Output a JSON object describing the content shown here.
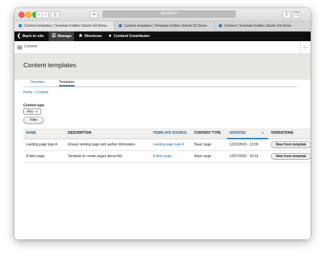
{
  "browser": {
    "address": "localhost",
    "tabs": [
      {
        "label": "Content templates | Template Entities Starter Kit Demo",
        "active": true
      },
      {
        "label": "Content templates | Template Entities Starter Kit Demo",
        "active": false
      },
      {
        "label": "Content | Template Entities Starter Kit Demo",
        "active": false
      }
    ]
  },
  "toolbar": {
    "back_label": "Back to site",
    "manage_label": "Manage",
    "shortcuts_label": "Shortcuts",
    "user_label": "Content Contributor"
  },
  "secondary_bar": {
    "content_label": "Content"
  },
  "page": {
    "title": "Content templates",
    "tabs": [
      "Overview",
      "Templates"
    ],
    "breadcrumb": "Home » Content"
  },
  "filter": {
    "label": "Content type",
    "selected": "- Any -",
    "button": "Filter"
  },
  "table": {
    "headers": [
      "NAME",
      "DESCRIPTION",
      "TEMPLATE SOURCE",
      "CONTENT TYPE",
      "UPDATED",
      "OPERATIONS"
    ],
    "rows": [
      {
        "name": "Landing page type A",
        "description": "A basic landing page with author information.",
        "source": "Landing page type A",
        "content_type": "Basic page",
        "updated": "12/22/2020 - 13:35",
        "operation": "New from template"
      },
      {
        "name": "A fishy page",
        "description": "Template to create pages about fish.",
        "source": "A fishy page",
        "content_type": "Basic page",
        "updated": "12/07/2020 - 18:14",
        "operation": "New from template"
      }
    ]
  },
  "colors": {
    "link": "#1a6aa1",
    "toolbar": "#0f0f0f",
    "header_bg": "#e7e6e2"
  }
}
